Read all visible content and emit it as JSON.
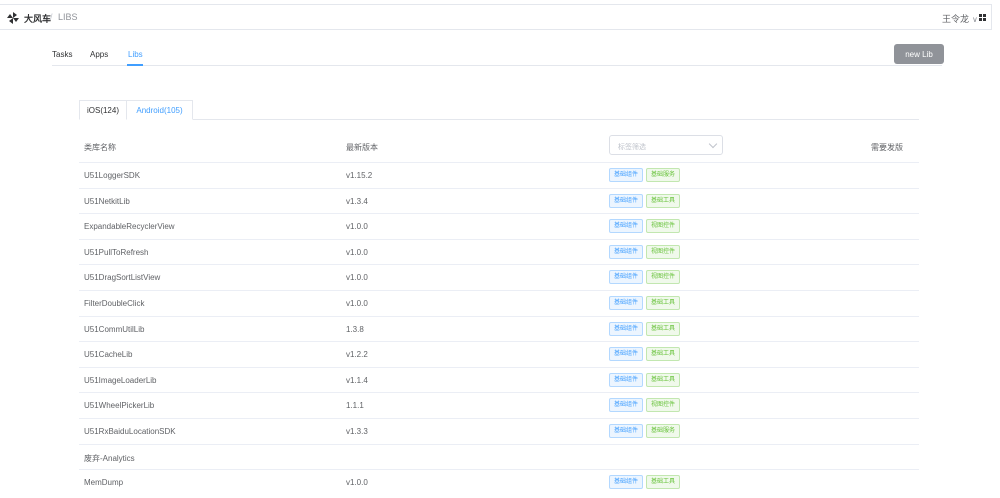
{
  "header": {
    "brand": "大风车",
    "separator": "/",
    "crumb": "LIBS",
    "user": "王令龙",
    "user_chevron": "∨"
  },
  "nav": {
    "tabs": [
      {
        "label": "Tasks",
        "active": false
      },
      {
        "label": "Apps",
        "active": false
      },
      {
        "label": "Libs",
        "active": true
      }
    ],
    "new_button": "new Lib"
  },
  "platform_tabs": [
    {
      "label": "iOS(124)",
      "active": false
    },
    {
      "label": "Android(105)",
      "active": true
    }
  ],
  "table": {
    "columns": {
      "name": "类库名称",
      "version": "最新版本",
      "tag_filter_placeholder": "标签筛选",
      "release": "需要发版"
    },
    "rows": [
      {
        "name": "U51LoggerSDK",
        "version": "v1.15.2",
        "tags": [
          {
            "label": "基础组件",
            "color": "blue"
          },
          {
            "label": "基础服务",
            "color": "green"
          }
        ]
      },
      {
        "name": "U51NetkitLib",
        "version": "v1.3.4",
        "tags": [
          {
            "label": "基础组件",
            "color": "blue"
          },
          {
            "label": "基础工具",
            "color": "green"
          }
        ]
      },
      {
        "name": "ExpandableRecyclerView",
        "version": "v1.0.0",
        "tags": [
          {
            "label": "基础组件",
            "color": "blue"
          },
          {
            "label": "视图控件",
            "color": "green"
          }
        ]
      },
      {
        "name": "U51PullToRefresh",
        "version": "v1.0.0",
        "tags": [
          {
            "label": "基础组件",
            "color": "blue"
          },
          {
            "label": "视图控件",
            "color": "green"
          }
        ]
      },
      {
        "name": "U51DragSortListView",
        "version": "v1.0.0",
        "tags": [
          {
            "label": "基础组件",
            "color": "blue"
          },
          {
            "label": "视图控件",
            "color": "green"
          }
        ]
      },
      {
        "name": "FilterDoubleClick",
        "version": "v1.0.0",
        "tags": [
          {
            "label": "基础组件",
            "color": "blue"
          },
          {
            "label": "基础工具",
            "color": "green"
          }
        ]
      },
      {
        "name": "U51CommUtilLib",
        "version": "1.3.8",
        "tags": [
          {
            "label": "基础组件",
            "color": "blue"
          },
          {
            "label": "基础工具",
            "color": "green"
          }
        ]
      },
      {
        "name": "U51CacheLib",
        "version": "v1.2.2",
        "tags": [
          {
            "label": "基础组件",
            "color": "blue"
          },
          {
            "label": "基础工具",
            "color": "green"
          }
        ]
      },
      {
        "name": "U51ImageLoaderLib",
        "version": "v1.1.4",
        "tags": [
          {
            "label": "基础组件",
            "color": "blue"
          },
          {
            "label": "基础工具",
            "color": "green"
          }
        ]
      },
      {
        "name": "U51WheelPickerLib",
        "version": "1.1.1",
        "tags": [
          {
            "label": "基础组件",
            "color": "blue"
          },
          {
            "label": "视图控件",
            "color": "green"
          }
        ]
      },
      {
        "name": "U51RxBaiduLocationSDK",
        "version": "v1.3.3",
        "tags": [
          {
            "label": "基础组件",
            "color": "blue"
          },
          {
            "label": "基础服务",
            "color": "green"
          }
        ]
      },
      {
        "name": "废弃-Analytics",
        "version": "",
        "tags": []
      },
      {
        "name": "MemDump",
        "version": "v1.0.0",
        "tags": [
          {
            "label": "基础组件",
            "color": "blue"
          },
          {
            "label": "基础工具",
            "color": "green"
          }
        ]
      }
    ]
  }
}
